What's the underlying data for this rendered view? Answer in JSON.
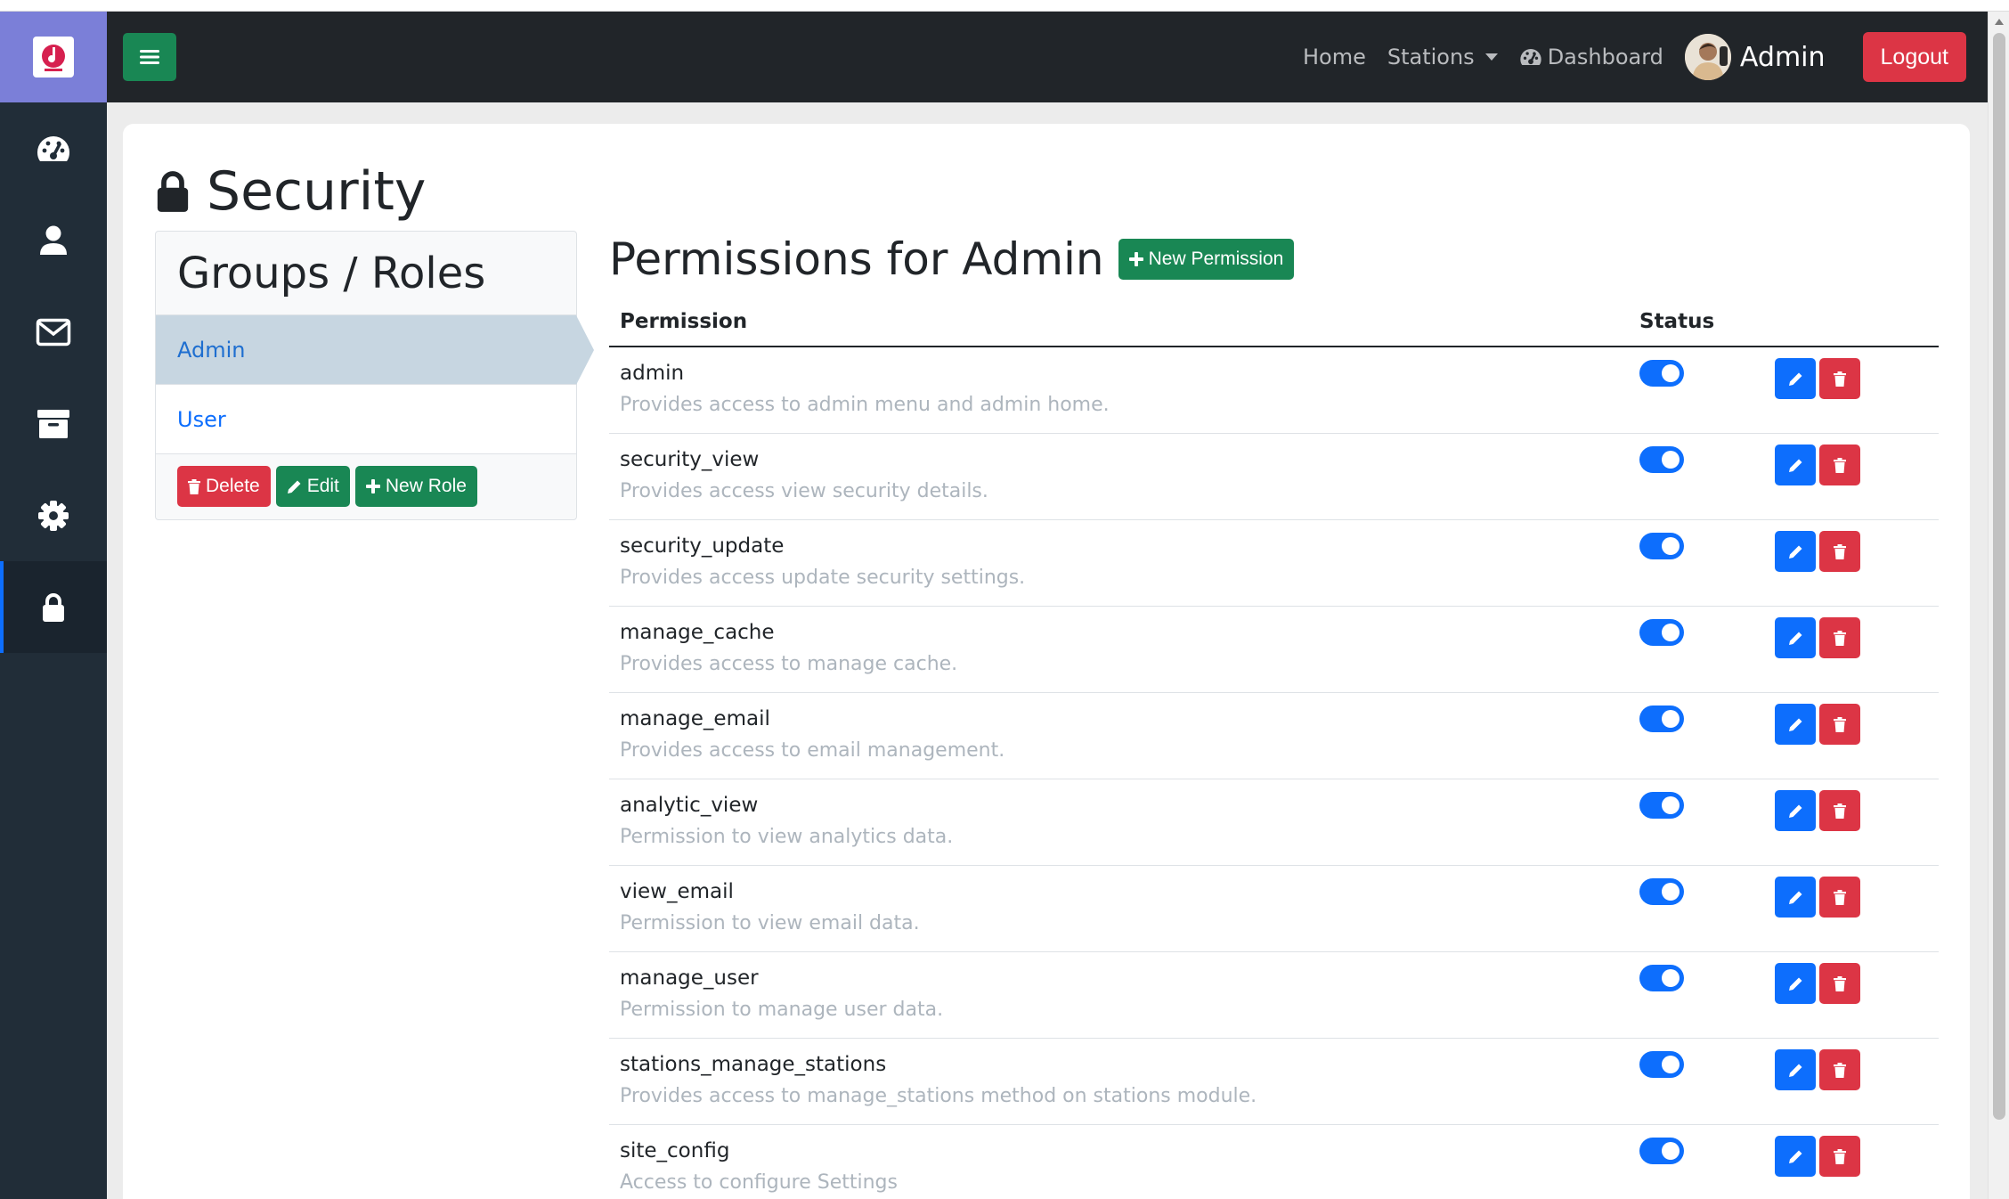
{
  "navbar": {
    "links": [
      "Home",
      "Stations",
      "Dashboard"
    ],
    "user_name": "Admin",
    "logout_label": "Logout"
  },
  "sidebar": {
    "items": [
      {
        "icon": "tachometer-icon",
        "active": false
      },
      {
        "icon": "user-icon",
        "active": false
      },
      {
        "icon": "envelope-icon",
        "active": false
      },
      {
        "icon": "archive-icon",
        "active": false
      },
      {
        "icon": "gear-icon",
        "active": false
      },
      {
        "icon": "lock-icon",
        "active": true
      }
    ]
  },
  "page": {
    "title": "Security"
  },
  "roles": {
    "header": "Groups / Roles",
    "items": [
      {
        "label": "Admin",
        "active": true
      },
      {
        "label": "User",
        "active": false
      }
    ],
    "delete_label": "Delete",
    "edit_label": "Edit",
    "new_role_label": "New Role"
  },
  "permissions": {
    "title": "Permissions for Admin",
    "new_label": "New Permission",
    "col_permission": "Permission",
    "col_status": "Status",
    "rows": [
      {
        "name": "admin",
        "desc": "Provides access to admin menu and admin home.",
        "enabled": true
      },
      {
        "name": "security_view",
        "desc": "Provides access view security details.",
        "enabled": true
      },
      {
        "name": "security_update",
        "desc": "Provides access update security settings.",
        "enabled": true
      },
      {
        "name": "manage_cache",
        "desc": "Provides access to manage cache.",
        "enabled": true
      },
      {
        "name": "manage_email",
        "desc": "Provides access to email management.",
        "enabled": true
      },
      {
        "name": "analytic_view",
        "desc": "Permission to view analytics data.",
        "enabled": true
      },
      {
        "name": "view_email",
        "desc": "Permission to view email data.",
        "enabled": true
      },
      {
        "name": "manage_user",
        "desc": "Permission to manage user data.",
        "enabled": true
      },
      {
        "name": "stations_manage_stations",
        "desc": "Provides access to manage_stations method on stations module.",
        "enabled": true
      },
      {
        "name": "site_config",
        "desc": "Access to configure Settings",
        "enabled": true
      }
    ]
  },
  "colors": {
    "sidebar_bg": "#212d38",
    "brand_bg": "#7b7fd8",
    "navbar_bg": "#212529",
    "primary": "#0d6efd",
    "success": "#198754",
    "danger": "#dc3545"
  }
}
